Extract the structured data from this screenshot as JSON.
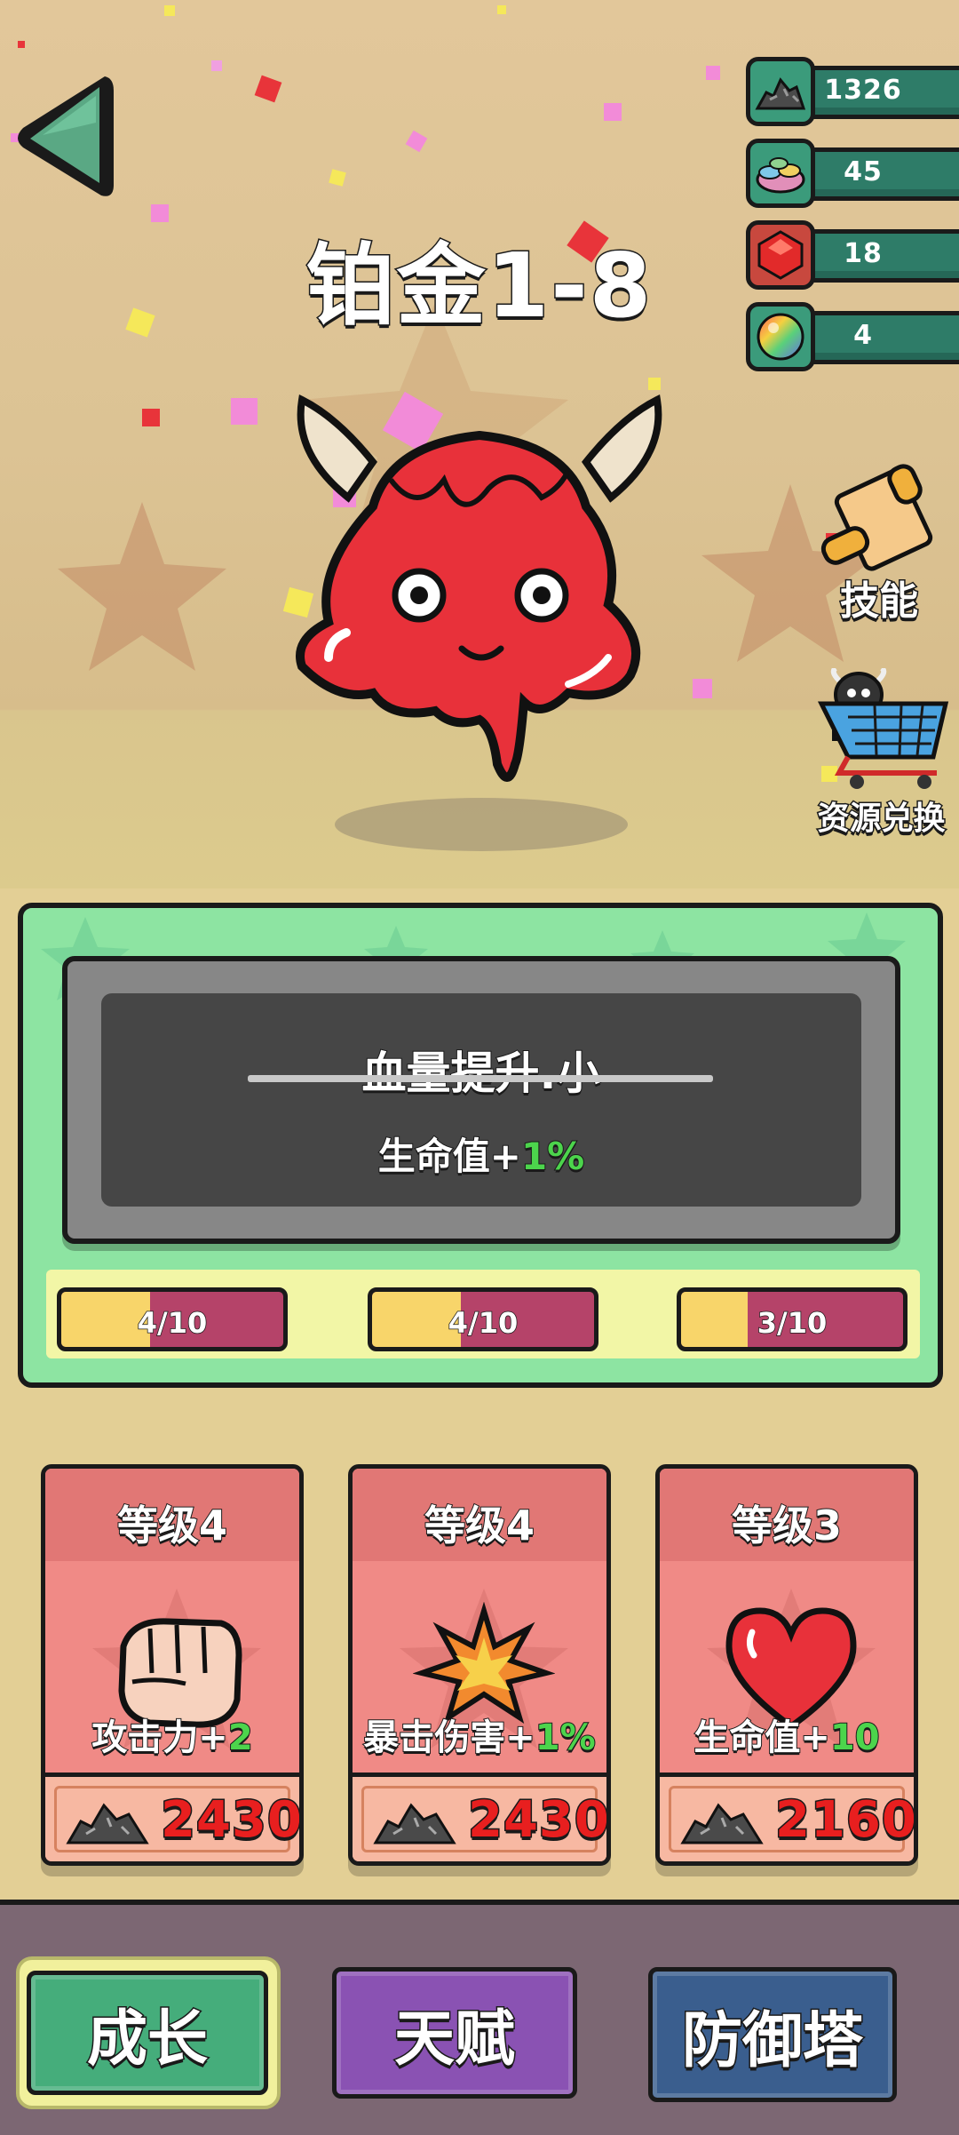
{
  "stage": {
    "title": "铂金1-8"
  },
  "resources": [
    {
      "name": "iron-ore",
      "icon": "ore-pile-icon",
      "value": "1326"
    },
    {
      "name": "gem-shards",
      "icon": "gem-pile-icon",
      "value": "45"
    },
    {
      "name": "ruby",
      "icon": "ruby-icon",
      "value": "18"
    },
    {
      "name": "rainbow-orb",
      "icon": "rainbow-orb-icon",
      "value": "4"
    }
  ],
  "side_buttons": {
    "skills": "技能",
    "exchange": "资源兑换"
  },
  "skill_panel": {
    "name": "血量提升.小",
    "effect_prefix": "生命值+",
    "effect_value": "1%",
    "progress": [
      {
        "label": "4/10",
        "fraction": 0.4
      },
      {
        "label": "4/10",
        "fraction": 0.4
      },
      {
        "label": "3/10",
        "fraction": 0.3
      }
    ]
  },
  "cards": [
    {
      "level": "等级4",
      "bonus_prefix": "攻击力+",
      "bonus_value": "2",
      "price": "2430",
      "icon": "fist-icon"
    },
    {
      "level": "等级4",
      "bonus_prefix": "暴击伤害+",
      "bonus_value": "1%",
      "price": "2430",
      "icon": "explosion-icon"
    },
    {
      "level": "等级3",
      "bonus_prefix": "生命值+",
      "bonus_value": "10",
      "price": "2160",
      "icon": "heart-icon"
    }
  ],
  "nav": {
    "growth": "成长",
    "talent": "天赋",
    "tower": "防御塔"
  },
  "colors": {
    "nav_growth": "#45ad7b",
    "nav_talent": "#8a52b3",
    "nav_tower": "#3a5e8e",
    "slime": "#e8313a",
    "panel_green": "#8de4a2"
  }
}
